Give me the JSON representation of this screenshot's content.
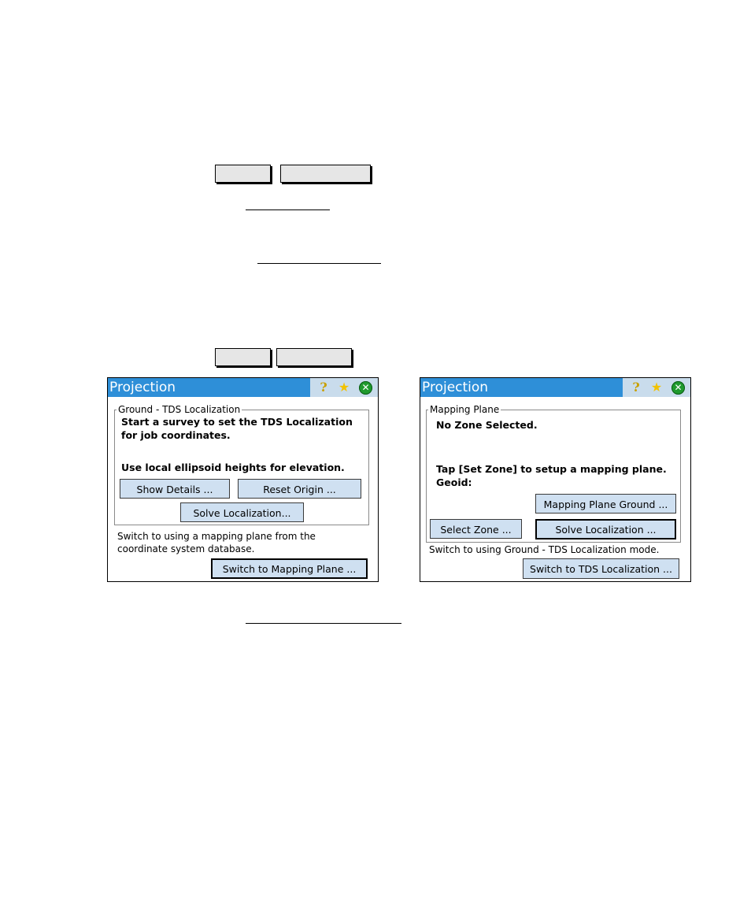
{
  "document": {
    "softkey_row_1": [
      "",
      ""
    ],
    "softkey_row_2": [
      "",
      ""
    ]
  },
  "dialogs": [
    {
      "title": "Projection",
      "icons": [
        "help-icon",
        "favorites-star-icon",
        "close-icon"
      ],
      "group_label": "Ground - TDS Localization",
      "bold_lines": [
        "Start a survey to set the TDS Localization",
        "for job coordinates.",
        "Use local ellipsoid heights for elevation."
      ],
      "buttons": {
        "show_details": "Show Details ...",
        "reset_origin": "Reset Origin ...",
        "solve_localization": "Solve Localization..."
      },
      "switch_text": [
        "Switch to using a mapping plane from the",
        "coordinate system database."
      ],
      "switch_button": "Switch to Mapping Plane ..."
    },
    {
      "title": "Projection",
      "icons": [
        "help-icon",
        "favorites-star-icon",
        "close-icon"
      ],
      "group_label": "Mapping Plane",
      "bold_lines": [
        "No Zone Selected.",
        "Tap [Set Zone] to setup a mapping plane.",
        "Geoid:"
      ],
      "buttons": {
        "mapping_plane_ground": "Mapping Plane Ground ...",
        "select_zone": "Select Zone ...",
        "solve_localization": "Solve Localization ..."
      },
      "switch_text": [
        "Switch to using  Ground - TDS Localization mode."
      ],
      "switch_button": "Switch to TDS Localization ..."
    }
  ],
  "glyphs": {
    "help": "?",
    "star": "★",
    "close": "✕"
  }
}
